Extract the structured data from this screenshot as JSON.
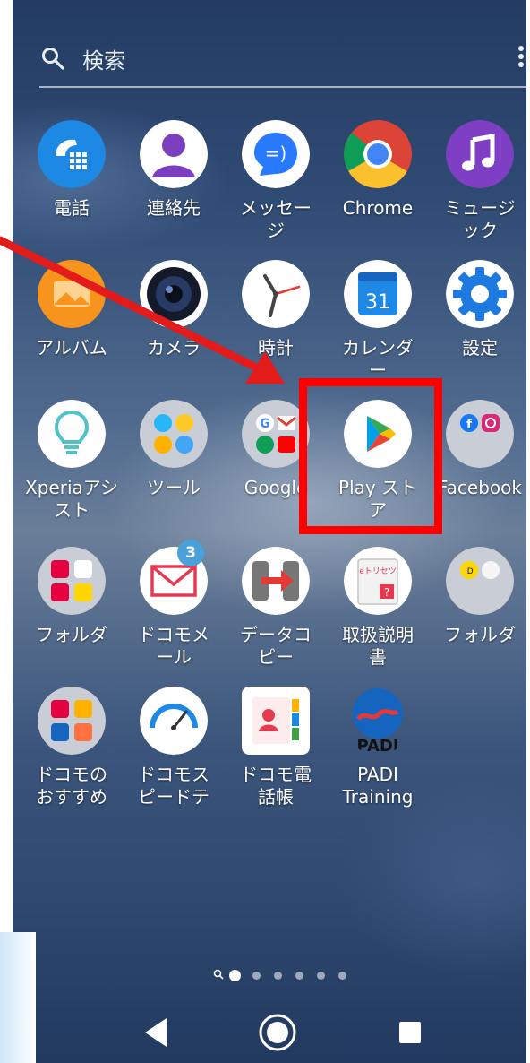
{
  "search": {
    "label": "検索"
  },
  "apps": [
    {
      "name": "電話"
    },
    {
      "name": "連絡先"
    },
    {
      "name": "メッセー\nジ"
    },
    {
      "name": "Chrome"
    },
    {
      "name": "ミュージ\nック"
    },
    {
      "name": "アルバム"
    },
    {
      "name": "カメラ"
    },
    {
      "name": "時計"
    },
    {
      "name": "カレンダ\nー"
    },
    {
      "name": "設定"
    },
    {
      "name": "Xperiaアシ\nスト"
    },
    {
      "name": "ツール"
    },
    {
      "name": "Google"
    },
    {
      "name": "Play スト\nア"
    },
    {
      "name": "Facebook"
    },
    {
      "name": "フォルダ"
    },
    {
      "name": "ドコモメ\nール",
      "badge": "3"
    },
    {
      "name": "データコ\nピー"
    },
    {
      "name": "取扱説明\n書"
    },
    {
      "name": "フォルダ"
    },
    {
      "name": "ドコモの\nおすすめ"
    },
    {
      "name": "ドコモス\nピードテ"
    },
    {
      "name": "ドコモ電\n話帳"
    },
    {
      "name": "PADI\nTraining"
    }
  ],
  "icon_text": {
    "calendar_day": "31",
    "manual_brand": "eトリセツ",
    "padi_logo": "PADI"
  },
  "colors": {
    "annotation": "#ff0000",
    "badge": "#4aa0d8"
  }
}
